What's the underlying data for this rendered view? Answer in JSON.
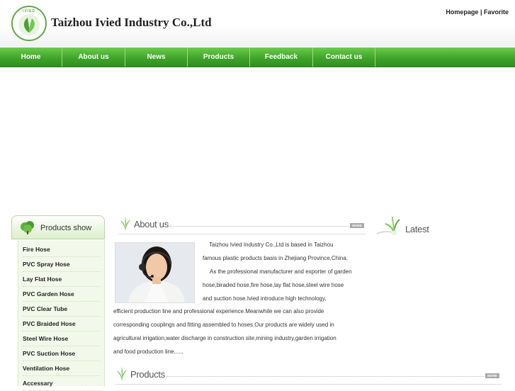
{
  "header": {
    "logo_ring_text": "IVIED",
    "company_name": "Taizhou Ivied Industry Co.,Ltd",
    "top_links": [
      "Homepage",
      "|",
      "Favorite"
    ]
  },
  "nav": {
    "items": [
      "Home",
      "About us",
      "News",
      "Products",
      "Feedback",
      "Contact us"
    ]
  },
  "sidebar": {
    "title": "Products show",
    "items": [
      "Fire Hose",
      "PVC Spray Hose",
      "Lay Flat Hose",
      "PVC Garden Hose",
      "PVC Clear Tube",
      "PVC Braided Hose",
      "Steel Wire Hose",
      "PVC Suction Hose",
      "Ventilation Hose",
      "Accessary"
    ]
  },
  "about": {
    "title": "About us",
    "more_label": "MORE",
    "lines": [
      "Taizhou Ivied Industry Co.,Ltd is based in Taizhou",
      "famous plastic products basis in Zhejiang Province,China.",
      "As the professional manufacturer and exporter of garden",
      "hose,biraded hose,fire hose,lay flat hose,steel wire hose",
      "and suction hose.Ivied introduce high technology,",
      "efficient production line and professional experience.Meanwhile we can also provide",
      "corresponding couplings and fitting assembled to hoses.Our products are widely used in",
      "agricultural irrigation,water discharge in construction site,mining industry,garden irrigation",
      "and food production line......"
    ]
  },
  "latest": {
    "title": "Latest"
  },
  "products": {
    "title": "Products",
    "more_label": "MORE"
  },
  "colors": {
    "nav_green": "#3fa52a",
    "side_bg": "#f3f9ea",
    "leaf_green": "#5ea945"
  }
}
